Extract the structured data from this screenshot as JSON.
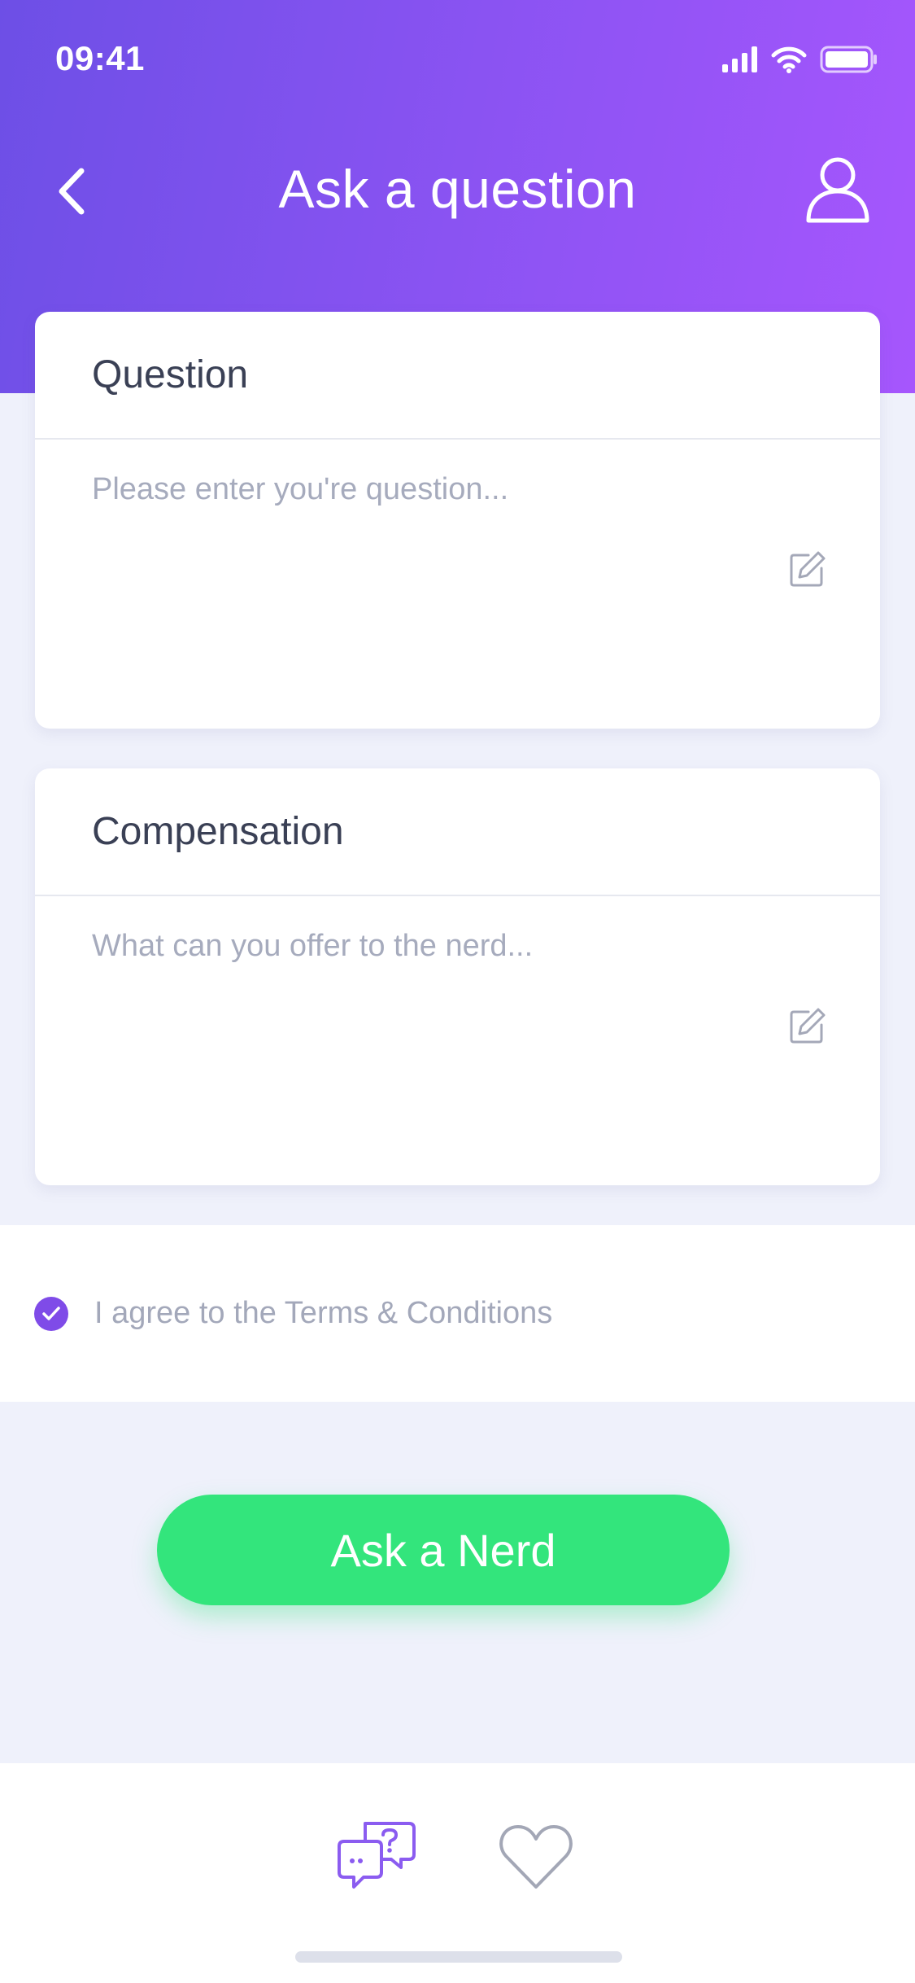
{
  "status_bar": {
    "time": "09:41"
  },
  "header": {
    "title": "Ask a question"
  },
  "question_card": {
    "label": "Question",
    "placeholder": "Please enter you're question..."
  },
  "compensation_card": {
    "label": "Compensation",
    "placeholder": "What can you offer to the nerd..."
  },
  "terms": {
    "text": "I agree to the Terms & Conditions",
    "checked": true
  },
  "ask_button": {
    "label": "Ask a Nerd"
  },
  "tab_bar": {
    "items": [
      {
        "icon": "question-chat-icon",
        "active": true
      },
      {
        "icon": "heart-icon",
        "active": false
      }
    ]
  },
  "colors": {
    "gradient_start": "#6d4fe6",
    "gradient_end": "#a656fd",
    "accent": "#7f4be8",
    "button": "#33e57c",
    "background": "#eff1fb"
  }
}
